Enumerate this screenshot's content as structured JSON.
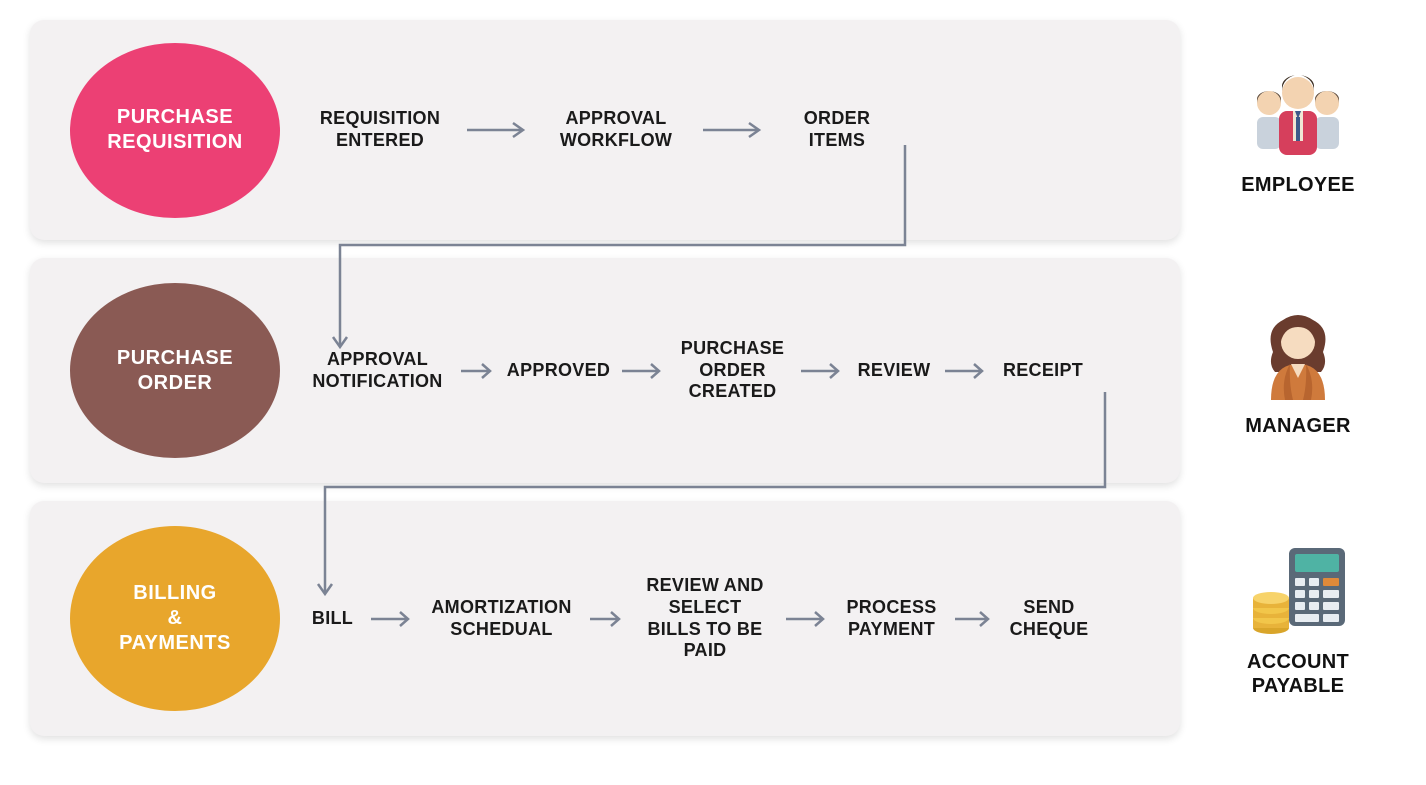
{
  "phases": {
    "requisition": {
      "title": "PURCHASE\nREQUISITION",
      "color": "#ec4074",
      "steps": [
        "REQUISITION\nENTERED",
        "APPROVAL\nWORKFLOW",
        "ORDER\nITEMS"
      ],
      "actor": "EMPLOYEE"
    },
    "order": {
      "title": "PURCHASE\nORDER",
      "color": "#8a5a54",
      "steps": [
        "APPROVAL\nNOTIFICATION",
        "APPROVED",
        "PURCHASE\nORDER\nCREATED",
        "REVIEW",
        "RECEIPT"
      ],
      "actor": "MANAGER"
    },
    "billing": {
      "title": "BILLING\n&\nPAYMENTS",
      "color": "#e8a62c",
      "steps": [
        "BILL",
        "AMORTIZATION\nSCHEDUAL",
        "REVIEW AND\nSELECT\nBILLS TO BE\nPAID",
        "PROCESS\nPAYMENT",
        "SEND\nCHEQUE"
      ],
      "actor": "ACCOUNT\nPAYABLE"
    }
  },
  "arrow_color": "#7b8394"
}
